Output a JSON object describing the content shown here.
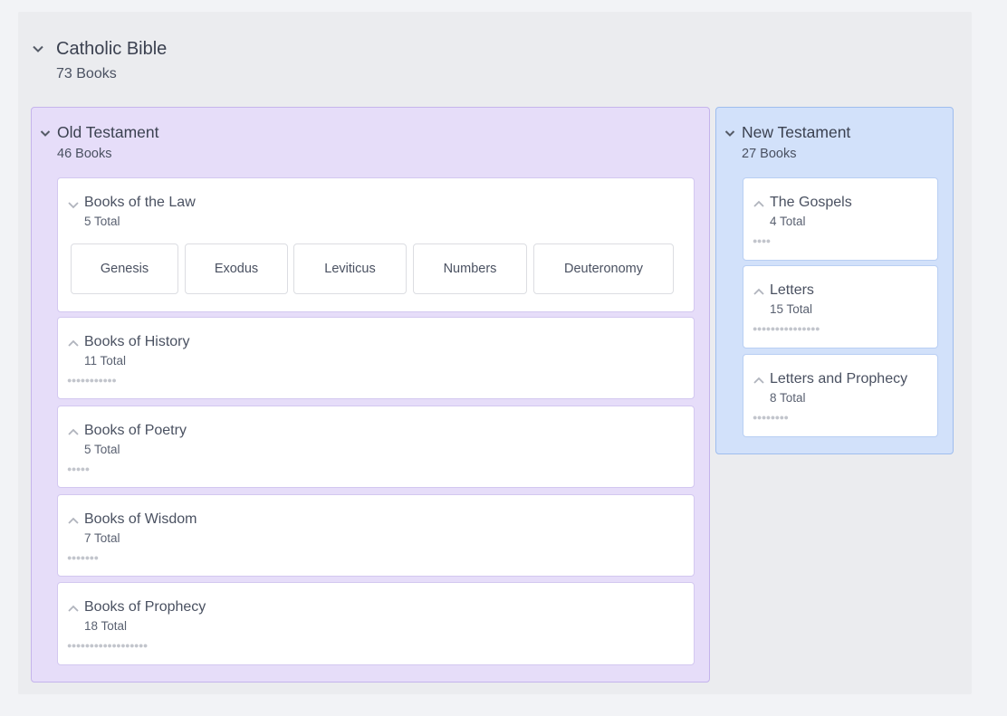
{
  "root": {
    "title": "Catholic Bible",
    "subtitle": "73 Books"
  },
  "old_testament": {
    "title": "Old Testament",
    "subtitle": "46 Books",
    "groups": [
      {
        "title": "Books of the Law",
        "subtitle": "5 Total",
        "expanded": true,
        "books": [
          "Genesis",
          "Exodus",
          "Leviticus",
          "Numbers",
          "Deuteronomy"
        ]
      },
      {
        "title": "Books of History",
        "subtitle": "11 Total",
        "dots": "●●●●●●●●●●●"
      },
      {
        "title": "Books of Poetry",
        "subtitle": "5 Total",
        "dots": "●●●●●"
      },
      {
        "title": "Books of Wisdom",
        "subtitle": "7 Total",
        "dots": "●●●●●●●"
      },
      {
        "title": "Books of Prophecy",
        "subtitle": "18 Total",
        "dots": "●●●●●●●●●●●●●●●●●●"
      }
    ]
  },
  "new_testament": {
    "title": "New Testament",
    "subtitle": "27 Books",
    "groups": [
      {
        "title": "The Gospels",
        "subtitle": "4 Total",
        "dots": "●●●●"
      },
      {
        "title": "Letters",
        "subtitle": "15 Total",
        "dots": "●●●●●●●●●●●●●●●"
      },
      {
        "title": "Letters and Prophecy",
        "subtitle": "8 Total",
        "dots": "●●●●●●●●"
      }
    ]
  },
  "icons": {
    "expanded": "chevron-down-icon",
    "collapsed": "chevron-up-icon"
  },
  "colors": {
    "old_testament_bg": "#e6ddf9",
    "new_testament_bg": "#d2e1fa",
    "outer_bg": "#ebecef"
  }
}
